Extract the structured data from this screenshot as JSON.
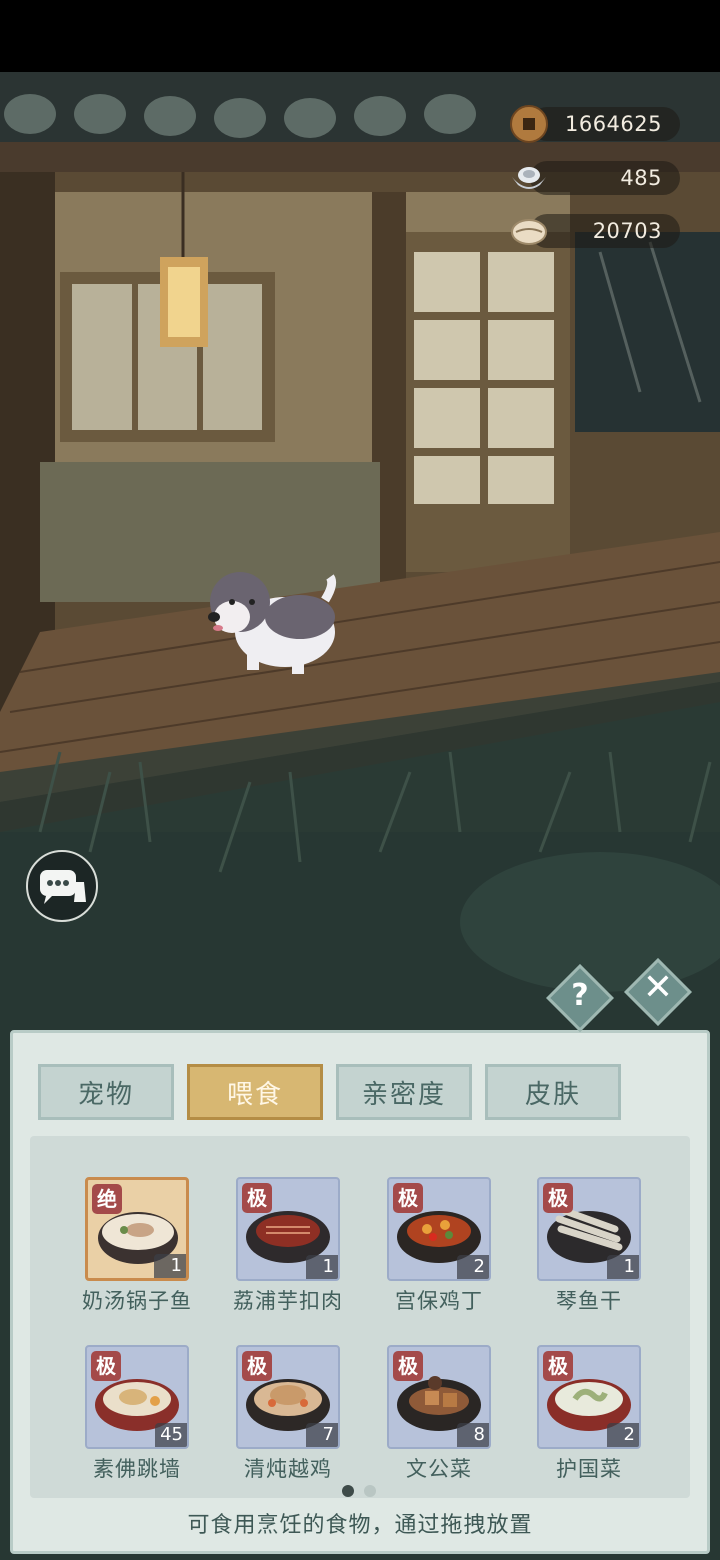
{
  "currencies": [
    {
      "icon": "copper-coin-icon",
      "value": "1664625"
    },
    {
      "icon": "silver-ingot-icon",
      "value": "485"
    },
    {
      "icon": "shell-icon",
      "value": "20703"
    }
  ],
  "tabs": [
    {
      "label": "宠物",
      "active": false
    },
    {
      "label": "喂食",
      "active": true
    },
    {
      "label": "亲密度",
      "active": false
    },
    {
      "label": "皮肤",
      "active": false
    }
  ],
  "items": [
    {
      "name": "奶汤锅子鱼",
      "grade": "绝",
      "count": "1"
    },
    {
      "name": "荔浦芋扣肉",
      "grade": "极",
      "count": "1"
    },
    {
      "name": "宫保鸡丁",
      "grade": "极",
      "count": "2"
    },
    {
      "name": "琴鱼干",
      "grade": "极",
      "count": "1"
    },
    {
      "name": "素佛跳墙",
      "grade": "极",
      "count": "45"
    },
    {
      "name": "清炖越鸡",
      "grade": "极",
      "count": "7"
    },
    {
      "name": "文公菜",
      "grade": "极",
      "count": "8"
    },
    {
      "name": "护国菜",
      "grade": "极",
      "count": "2"
    }
  ],
  "pagination": {
    "current": 1,
    "total": 2
  },
  "hint": "可食用烹饪的食物，通过拖拽放置",
  "buttons": {
    "help": "?",
    "close": "✕"
  },
  "colors": {
    "active_tab": "#d7b772",
    "panel": "#dfe8e4",
    "grade_badge": "#a44a4a"
  }
}
